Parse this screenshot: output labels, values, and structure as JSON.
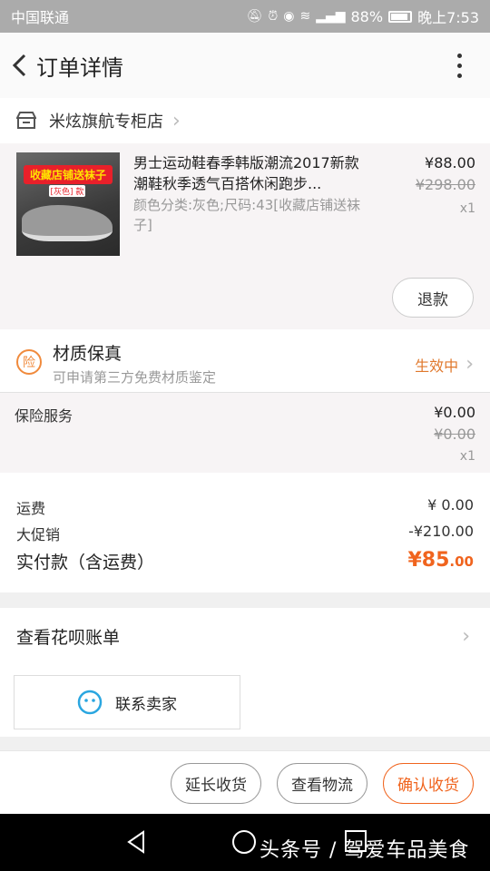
{
  "status_bar": {
    "carrier": "中国联通",
    "battery": "88%",
    "time": "晚上7:53"
  },
  "header": {
    "title": "订单详情"
  },
  "shop": {
    "name": "米炫旗航专柜店"
  },
  "product": {
    "image_banner": "收藏店铺送袜子",
    "image_sub": "[灰色] 款",
    "title": "男士运动鞋春季韩版潮流2017新款潮鞋秋季透气百搭休闲跑步...",
    "attributes": "颜色分类:灰色;尺码:43[收藏店铺送袜子]",
    "price": "¥88.00",
    "original_price": "¥298.00",
    "quantity": "x1",
    "refund_label": "退款"
  },
  "quality": {
    "icon_char": "险",
    "title": "材质保真",
    "subtitle": "可申请第三方免费材质鉴定",
    "status": "生效中"
  },
  "insurance": {
    "label": "保险服务",
    "price": "¥0.00",
    "original_price": "¥0.00",
    "quantity": "x1"
  },
  "fees": {
    "shipping_label": "运费",
    "shipping_value": "¥ 0.00",
    "promo_label": "大促销",
    "promo_value": "-¥210.00",
    "total_label": "实付款（含运费）",
    "total_big": "¥85",
    "total_small": ".00"
  },
  "huabei": {
    "label": "查看花呗账单"
  },
  "contact": {
    "label": "联系卖家"
  },
  "actions": {
    "extend_label": "延长收货",
    "logistics_label": "查看物流",
    "confirm_label": "确认收货"
  },
  "watermark": "头条号 / 驾爱车品美食",
  "colors": {
    "accent": "#f0641e",
    "status_orange": "#e0782c"
  }
}
